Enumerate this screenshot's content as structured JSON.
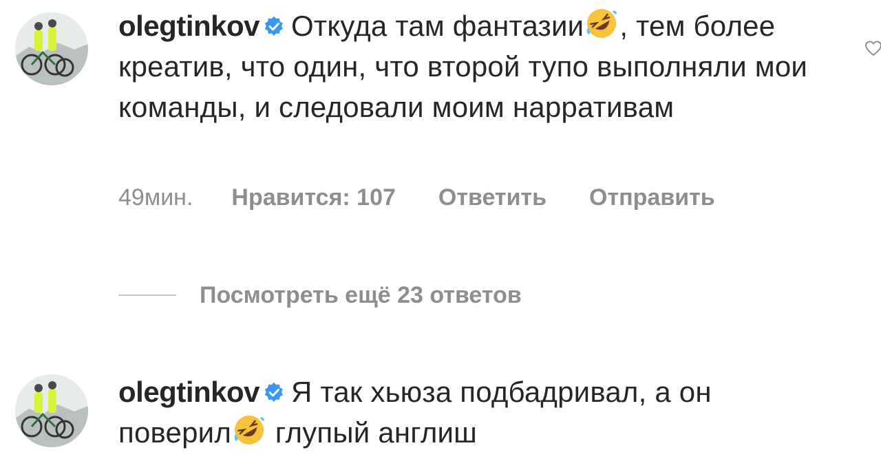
{
  "comments": [
    {
      "username": "olegtinkov",
      "text_before_emoji": "Откуда там фантазии",
      "emoji": "rolling-on-floor-laughing-icon",
      "text_after_emoji": ", тем более креатив, что один, что второй тупо выполняли мои команды, и следовали моим нарративам",
      "time": "49мин.",
      "likes": "Нравится: 107",
      "reply_label": "Ответить",
      "send_label": "Отправить",
      "view_replies": "Посмотреть ещё 23 ответов"
    },
    {
      "username": "olegtinkov",
      "text_before_emoji": "Я так хьюза подбадривал, а он поверил",
      "emoji": "rolling-on-floor-laughing-icon",
      "text_after_emoji": " глупый англиш"
    }
  ],
  "colors": {
    "verified_badge": "#3897f0",
    "meta_text": "#8e8e8e",
    "primary_text": "#262626"
  }
}
